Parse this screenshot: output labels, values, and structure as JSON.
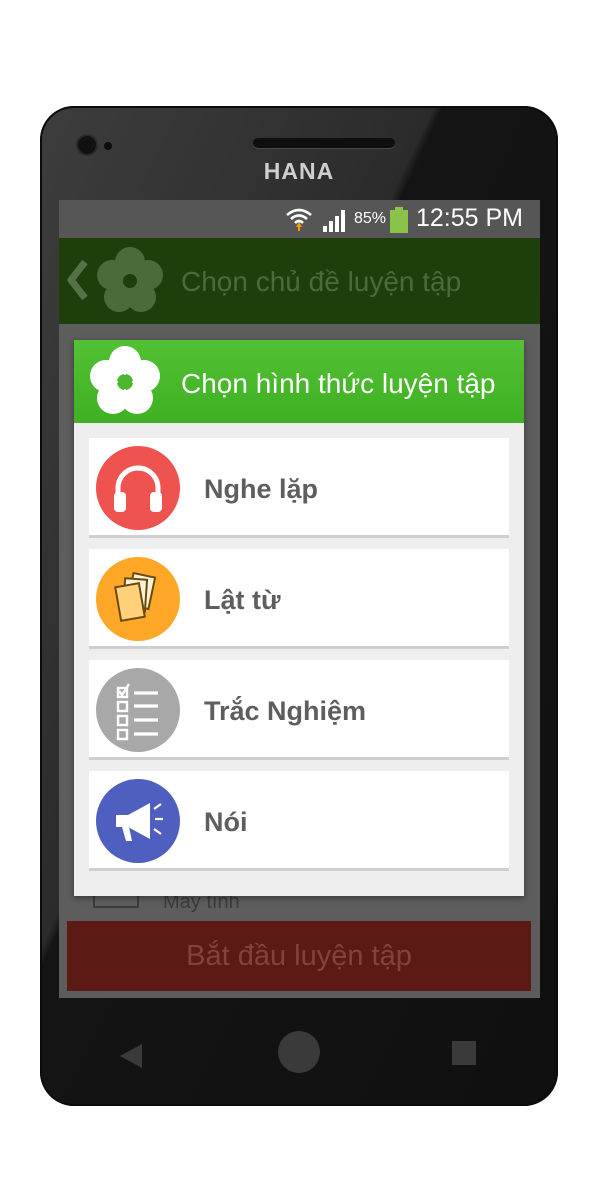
{
  "device": {
    "brand": "HANA"
  },
  "status_bar": {
    "battery_percent": "85%",
    "time": "12:55 PM",
    "battery_level": 0.85
  },
  "app_bar": {
    "title": "Chọn chủ đề luyện tập",
    "back_icon": "chevron-left-icon",
    "logo_icon": "flower-logo-icon"
  },
  "background": {
    "list_item_label": "Máy tính",
    "start_button_label": "Bắt đầu luyện tập"
  },
  "dialog": {
    "title": "Chọn hình thức luyện tập",
    "logo_icon": "flower-logo-icon",
    "options": [
      {
        "label": "Nghe lặp",
        "icon": "headphones-icon",
        "color": "#ef5350"
      },
      {
        "label": "Lật từ",
        "icon": "flashcards-icon",
        "color": "#ffa726"
      },
      {
        "label": "Trắc Nghiệm",
        "icon": "checklist-icon",
        "color": "#a8a8a8"
      },
      {
        "label": "Nói",
        "icon": "megaphone-icon",
        "color": "#4f5fbf"
      }
    ]
  },
  "colors": {
    "accent_green": "#4caf2a",
    "appbar_dim": "#1d3f0c",
    "start_button_dim": "#5b1a14"
  }
}
